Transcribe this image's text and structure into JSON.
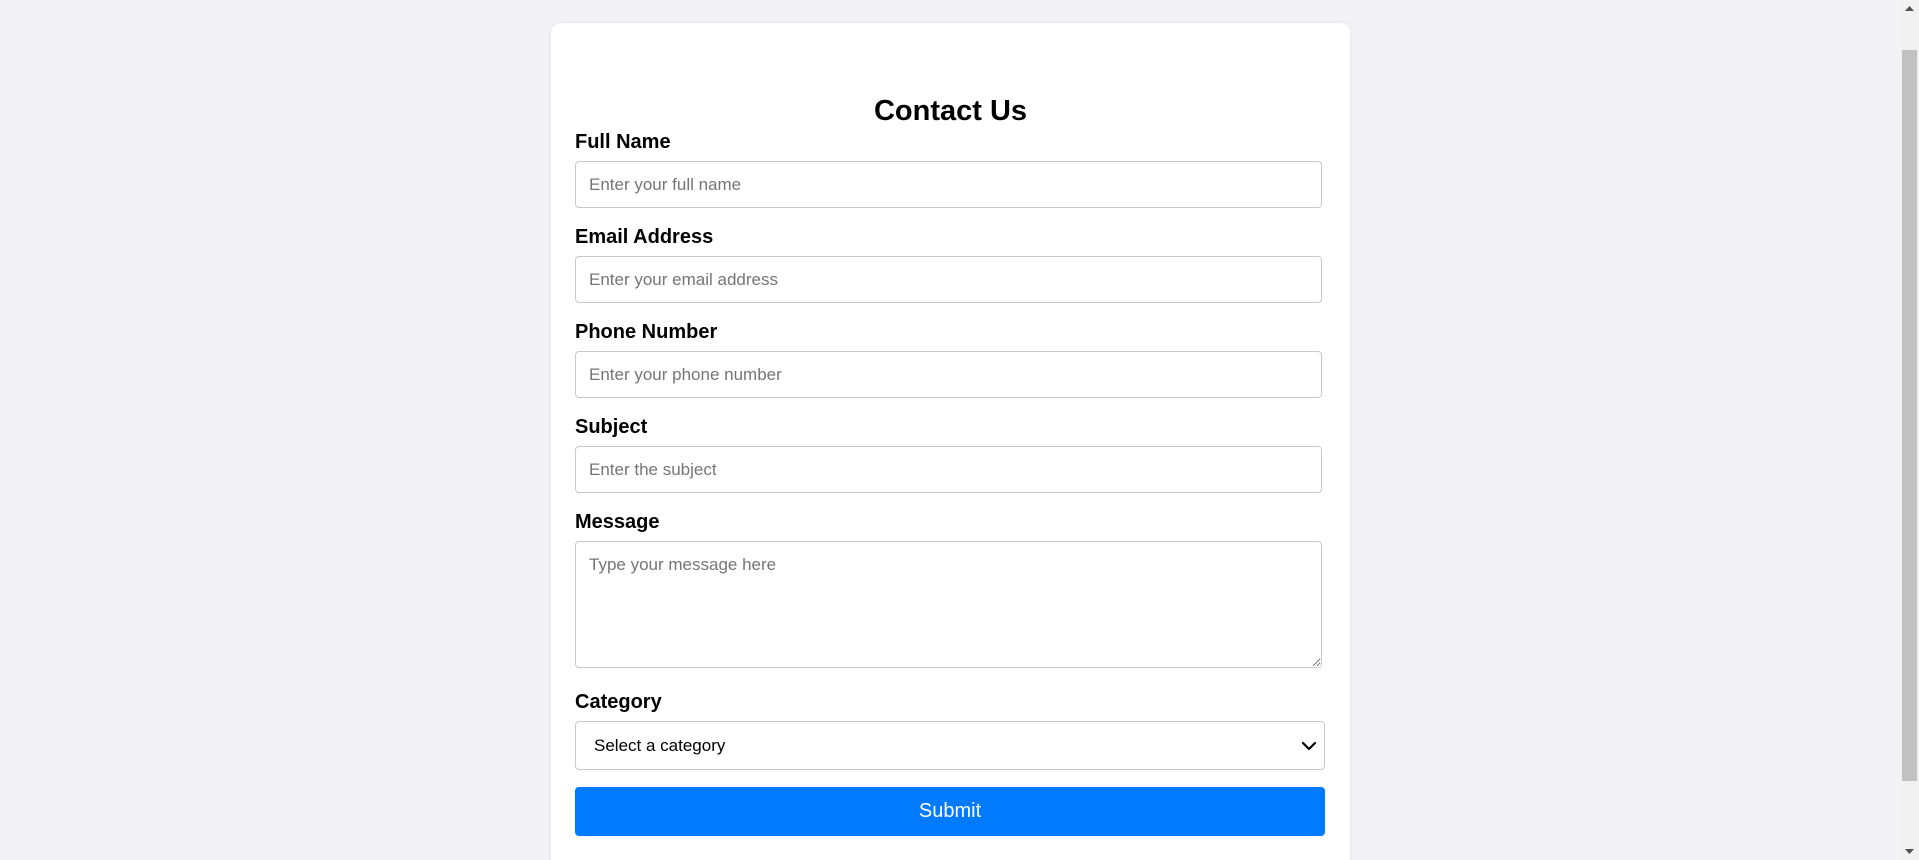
{
  "form": {
    "title": "Contact Us",
    "fields": {
      "full_name": {
        "label": "Full Name",
        "placeholder": "Enter your full name",
        "value": ""
      },
      "email": {
        "label": "Email Address",
        "placeholder": "Enter your email address",
        "value": ""
      },
      "phone": {
        "label": "Phone Number",
        "placeholder": "Enter your phone number",
        "value": ""
      },
      "subject": {
        "label": "Subject",
        "placeholder": "Enter the subject",
        "value": ""
      },
      "message": {
        "label": "Message",
        "placeholder": "Type your message here",
        "value": ""
      },
      "category": {
        "label": "Category",
        "selected": "Select a category"
      }
    },
    "submit_label": "Submit"
  },
  "colors": {
    "page_background": "#f3f3f7",
    "card_background": "#ffffff",
    "accent": "#007bff",
    "border": "#c9c9c9"
  },
  "icons": {
    "select_arrow": "chevron-down-icon",
    "scroll_up": "scroll-up-arrow-icon",
    "scroll_down": "scroll-down-arrow-icon"
  }
}
